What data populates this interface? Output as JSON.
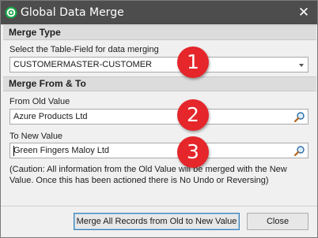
{
  "window": {
    "title": "Global Data Merge",
    "close_symbol": "✕"
  },
  "merge_type": {
    "header": "Merge Type",
    "select_label": "Select the Table-Field for data merging",
    "selected_value": "CUSTOMERMASTER-CUSTOMER"
  },
  "merge_from_to": {
    "header": "Merge From & To",
    "old_label": "From Old Value",
    "old_value": "Azure Products Ltd",
    "new_label": "To New Value",
    "new_value": "Green Fingers Maloy Ltd",
    "caution": "(Caution: All information from the Old Value will be merged with the New Value. Once this has been actioned there is No Undo or Reversing)"
  },
  "buttons": {
    "merge": "Merge All Records from Old to New Value",
    "close": "Close"
  },
  "markers": [
    "1",
    "2",
    "3"
  ],
  "icons": {
    "app": "app-logo-icon",
    "lookup": "magnifier-lookup-icon",
    "dropdown": "dropdown-arrow-icon",
    "close": "close-icon"
  },
  "colors": {
    "titlebar": "#4d4d4d",
    "section_header": "#dcdcdc",
    "marker": "#e5262a",
    "default_button_border": "#3c7fb1"
  }
}
